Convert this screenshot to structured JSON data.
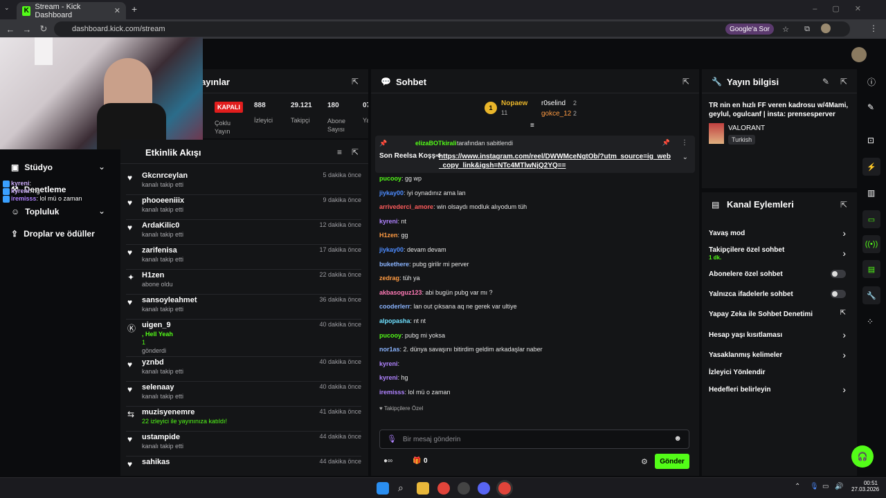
{
  "browser": {
    "tab_title": "Stream - Kick Dashboard",
    "url": "dashboard.kick.com/stream",
    "google_btn": "Google'a Sor"
  },
  "nav": {
    "studio": "Stüdyo",
    "moderation": "Denetleme",
    "community": "Topluluk",
    "drops": "Droplar ve ödüller"
  },
  "overlay_chat": [
    {
      "user": "kyreni",
      "text": ":"
    },
    {
      "user": "kyreni",
      "text": ": hg"
    },
    {
      "user": "iremisss",
      "text": ": lol mü o zaman"
    }
  ],
  "stats": {
    "title": "Yayınlar",
    "status": "KAPALI",
    "multi": "Çoklu Yayın",
    "viewers_val": "888",
    "viewers": "İzleyici",
    "followers_val": "29.121",
    "followers": "Takipçi",
    "subs_val": "180",
    "subs": "Abone Sayısı",
    "other_val": "07",
    "other": "Ya"
  },
  "activity": {
    "title": "Etkinlik Akışı",
    "rows": [
      {
        "name": "Gkcnrceylan",
        "sub": "kanalı takip etti",
        "time": "5 dakika önce",
        "icon": "heart"
      },
      {
        "name": "phooeeniiix",
        "sub": "kanalı takip etti",
        "time": "9 dakika önce",
        "icon": "heart"
      },
      {
        "name": "ArdaKilic0",
        "sub": "kanalı takip etti",
        "time": "12 dakika önce",
        "icon": "heart"
      },
      {
        "name": "zarifenisa",
        "sub": "kanalı takip etti",
        "time": "17 dakika önce",
        "icon": "heart"
      },
      {
        "name": "H1zen",
        "sub": "abone oldu",
        "time": "22 dakika önce",
        "icon": "star"
      },
      {
        "name": "sansoyleahmet",
        "sub": "kanalı takip etti",
        "time": "36 dakika önce",
        "icon": "heart"
      },
      {
        "name": "uigen_9",
        "sub": ", Hell Yeah",
        "sub2": "1",
        "sub3": "gönderdi",
        "time": "40 dakika önce",
        "icon": "kick"
      },
      {
        "name": "yznbd",
        "sub": "kanalı takip etti",
        "time": "40 dakika önce",
        "icon": "heart"
      },
      {
        "name": "selenaay",
        "sub": "kanalı takip etti",
        "time": "40 dakika önce",
        "icon": "heart"
      },
      {
        "name": "muzisyenemre",
        "sub": "22 izleyici ile yayınınıza katıldı!",
        "time": "41 dakika önce",
        "icon": "raid"
      },
      {
        "name": "ustampide",
        "sub": "kanalı takip etti",
        "time": "44 dakika önce",
        "icon": "heart"
      },
      {
        "name": "sahikas",
        "sub": "",
        "time": "44 dakika önce",
        "icon": "heart"
      }
    ]
  },
  "chat": {
    "title": "Sohbet",
    "top1": "Nopaew",
    "top1_count": "11",
    "top2": "r0selind",
    "top2_count": "2",
    "top3": "gokce_12",
    "top3_count": "2",
    "pinned_by": "elizaBOTkirali",
    "pinned_suffix": "tarafından sabitlendi",
    "pinned_text": "Son Reelsa Koşş➾",
    "pinned_link": "https://www.instagram.com/reel/DWWMceNgtOb/?utm_source=ig_web_copy_link&igsh=NTc4MTlwNjQ2YQ==",
    "messages": [
      {
        "user": "pucooy",
        "color": "#53fc18",
        "text": ": gg wp"
      },
      {
        "user": "jiykay00",
        "color": "#4d8cff",
        "text": ": iyi oynadınız ama lan"
      },
      {
        "user": "arrivederci_amore",
        "color": "#ff5c5c",
        "text": ": win olsaydı modluk alıyodum tüh"
      },
      {
        "user": "kyreni",
        "color": "#b083ff",
        "text": ": nt"
      },
      {
        "user": "H1zen",
        "color": "#ff9b42",
        "text": ": gg"
      },
      {
        "user": "jiykay00",
        "color": "#4d8cff",
        "text": ": devam devam"
      },
      {
        "user": "bukethere",
        "color": "#8ab4ff",
        "text": ": pubg girilir mi perver"
      },
      {
        "user": "zedrag",
        "color": "#ff9b42",
        "text": ": tüh ya"
      },
      {
        "user": "akbasoguz123",
        "color": "#ff7ab6",
        "text": ": abi bugün pubg var mı ?"
      },
      {
        "user": "cooderlerr",
        "color": "#8ab4ff",
        "text": ": lan out çıksana aq ne gerek var ultiye"
      },
      {
        "user": "alpopasha",
        "color": "#6ee0ff",
        "text": ": nt nt"
      },
      {
        "user": "pucooy",
        "color": "#53fc18",
        "text": ": pubg mi yoksa"
      },
      {
        "user": "nor1as",
        "color": "#8ab4ff",
        "text": ": 2. dünya savaşını bitirdim geldim arkadaşlar naber"
      },
      {
        "user": "kyreni",
        "color": "#b083ff",
        "text": ":"
      },
      {
        "user": "kyreni",
        "color": "#b083ff",
        "text": ": hg"
      },
      {
        "user": "iremisss",
        "color": "#b083ff",
        "text": ": lol mü o zaman"
      }
    ],
    "followers_only": "Takipçilere Özel",
    "placeholder": "Bir mesaj gönderin",
    "send": "Gönder",
    "count": "0"
  },
  "info": {
    "title": "Yayın bilgisi",
    "stream_title": "TR nin en hızlı FF veren kadrosu w/4Mami, geylul, ogulcanf | insta: prensesperver",
    "game": "VALORANT",
    "lang": "Turkish"
  },
  "actions": {
    "title": "Kanal Eylemleri",
    "slow": "Yavaş mod",
    "followers_chat": "Takipçilere özel sohbet",
    "followers_dur": "1 dk.",
    "subs_chat": "Abonelere özel sohbet",
    "emote_chat": "Yalnızca ifadelerle sohbet",
    "ai_mod": "Yapay Zeka ile Sohbet Denetimi",
    "age": "Hesap yaşı kısıtlaması",
    "banned": "Yasaklanmış kelimeler",
    "redirect": "İzleyici Yönlendir",
    "goals": "Hedefleri belirleyin"
  },
  "taskbar": {
    "time": "00:51",
    "date": "27.03.2026"
  },
  "colors": {
    "accent": "#53fc18",
    "panel": "#141517",
    "bg": "#0b0c0e"
  }
}
